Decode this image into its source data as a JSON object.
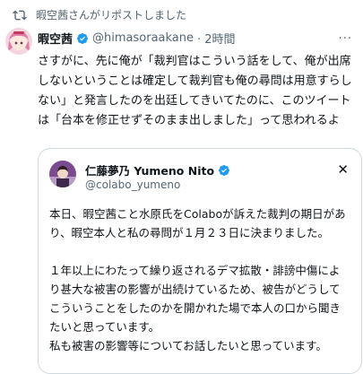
{
  "repost": {
    "text": "暇空茜さんがリポストしました",
    "icon": "repost-icon"
  },
  "tweet": {
    "display_name": "暇空茜",
    "handle": "@himasoraakane",
    "time": "· 2時間",
    "more": "···",
    "body": "さすがに、先に俺が「裁判官はこういう話をして、俺が出席しないということは確定して裁判官も俺の尋問は用意すらしない」と発言したのを出廷してきいてたのに、このツイートは「台本を修正せずそのまま出しました」って思われるよ"
  },
  "quote": {
    "display_name": "仁藤夢乃 Yumeno Nito",
    "handle": "@colabo_yumeno",
    "close": "✕",
    "paragraph1": "本日、暇空茜こと水原氏をColaboが訴えた裁判の期日があり、暇空本人と私の尋問が１月２３日に決まりました。",
    "paragraph2": "１年以上にわたって繰り返されるデマ拡散・誹謗中傷により甚大な被害の影響が出続けているため、被告がどうしてこういうことをしたのかを開かれた場で本人の口から聞きたいと思っています。",
    "paragraph3": "私も被害の影響等についてお話したいと思っています。"
  },
  "colors": {
    "verified_blue": "#1d9bf0",
    "secondary_text": "#536471",
    "border": "#cfd9de"
  }
}
